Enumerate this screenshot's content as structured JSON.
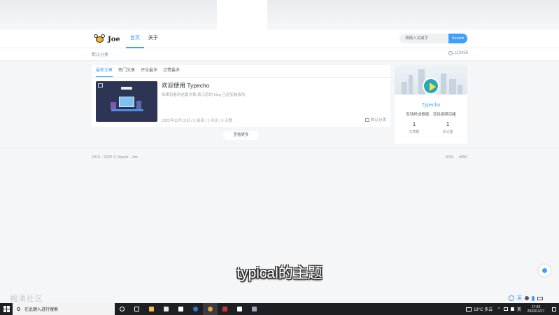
{
  "site": {
    "logo_text": "Joe",
    "nav": [
      {
        "label": "首页",
        "active": true
      },
      {
        "label": "关于",
        "active": false
      }
    ],
    "search": {
      "placeholder": "请输入关键字",
      "button": "Search"
    },
    "subbar": {
      "category": "默认分类",
      "user": "123456"
    }
  },
  "posts_card": {
    "tabs": [
      "最新文章",
      "热门文章",
      "评论最多",
      "点赞最多"
    ],
    "post": {
      "title": "欢迎使用 Typecho",
      "excerpt": "如果您看到这篇文章,表示您的 blog 已经安装成功.",
      "meta": "2022年11月13日 / 3 阅读 / 1 评论 / 0 点赞",
      "category": "默认分类"
    },
    "load_more": "查看更多"
  },
  "profile": {
    "name": "Typecho",
    "motto": "有钱终成眷属，没钱亲眼目睹",
    "stats": [
      {
        "value": "1",
        "label": "文章数"
      },
      {
        "value": "1",
        "label": "评论量"
      }
    ]
  },
  "footer": {
    "copyright": "2019 - 2020 © Reach - Joe",
    "links": [
      "RSS",
      "MAP"
    ]
  },
  "overlay": {
    "caption": "typical的主题",
    "watermark": "福清社区"
  },
  "taskbar": {
    "search_placeholder": "在此键入进行搜索",
    "weather": "13°C 多云",
    "ime_label": "英",
    "time": "17:03",
    "date": "2022/11/17"
  },
  "colors": {
    "accent": "#409eff",
    "taskbar": "#1e1f22",
    "background": "#f5f6f7"
  }
}
